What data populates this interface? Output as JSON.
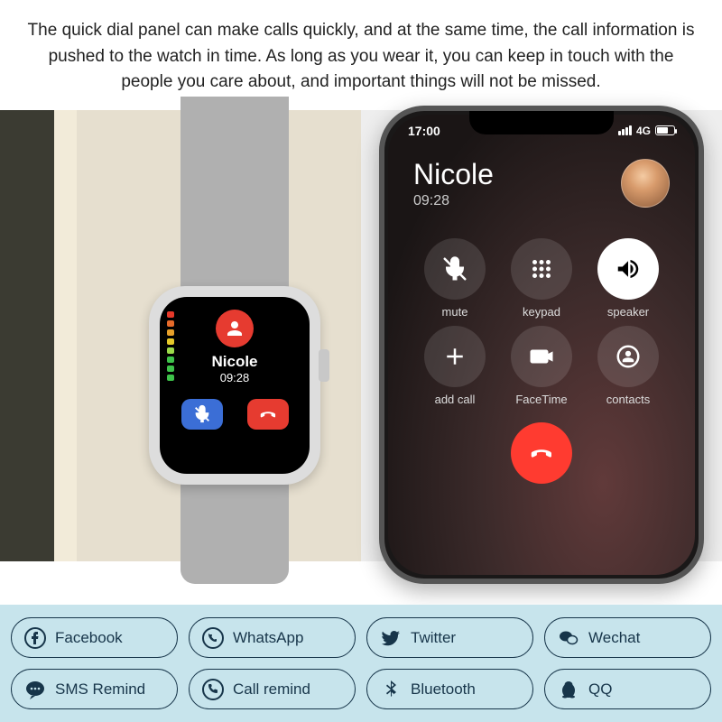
{
  "header": {
    "text": "The quick dial panel can make calls quickly, and at the same time, the call information is pushed to the watch in time. As long as you wear it, you can keep in touch with the people you care about, and important things will not be missed."
  },
  "watch": {
    "caller_name": "Nicole",
    "call_time": "09:28"
  },
  "phone": {
    "status": {
      "time": "17:00",
      "network": "4G"
    },
    "caller_name": "Nicole",
    "call_time": "09:28",
    "buttons": {
      "mute": "mute",
      "keypad": "keypad",
      "speaker": "speaker",
      "add_call": "add call",
      "facetime": "FaceTime",
      "contacts": "contacts"
    }
  },
  "apps": [
    {
      "icon": "facebook",
      "label": "Facebook"
    },
    {
      "icon": "whatsapp",
      "label": "WhatsApp"
    },
    {
      "icon": "twitter",
      "label": "Twitter"
    },
    {
      "icon": "wechat",
      "label": "Wechat"
    },
    {
      "icon": "sms",
      "label": "SMS Remind"
    },
    {
      "icon": "call",
      "label": "Call remind"
    },
    {
      "icon": "bluetooth",
      "label": "Bluetooth"
    },
    {
      "icon": "qq",
      "label": "QQ"
    }
  ]
}
